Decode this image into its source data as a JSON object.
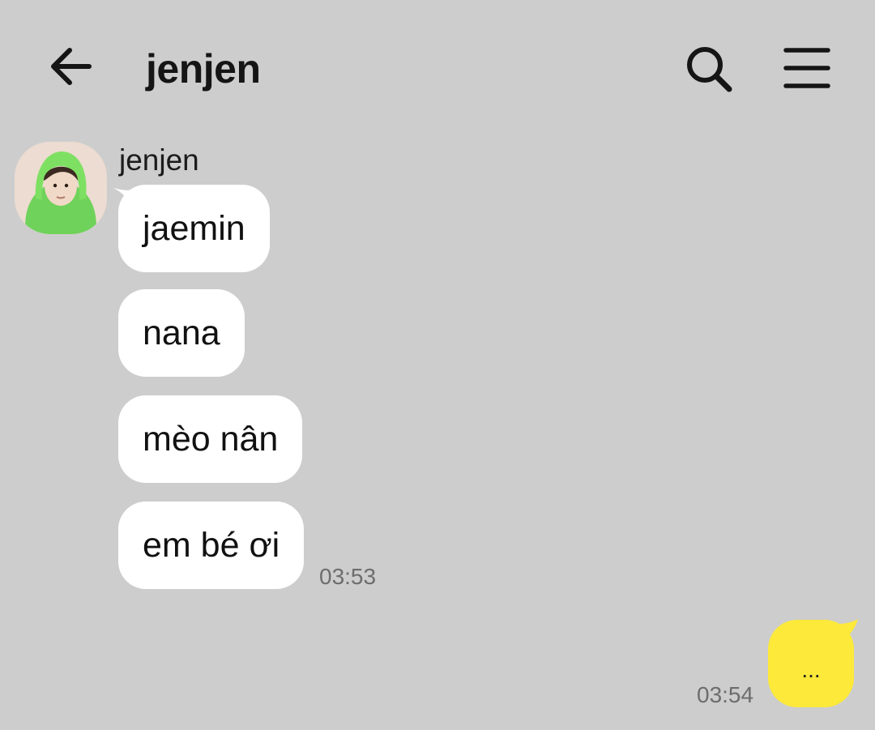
{
  "header": {
    "title": "jenjen",
    "back_icon": "arrow-left-icon",
    "search_icon": "search-icon",
    "menu_icon": "hamburger-menu-icon"
  },
  "colors": {
    "background": "#cdcdcd",
    "incoming_bubble": "#ffffff",
    "outgoing_bubble": "#fce939",
    "timestamp": "#6d6d6d"
  },
  "incoming": {
    "sender": "jenjen",
    "messages": [
      "jaemin",
      "nana",
      "mèo nân",
      "em bé ơi"
    ],
    "time": "03:53"
  },
  "outgoing": {
    "text": "...",
    "time": "03:54"
  }
}
